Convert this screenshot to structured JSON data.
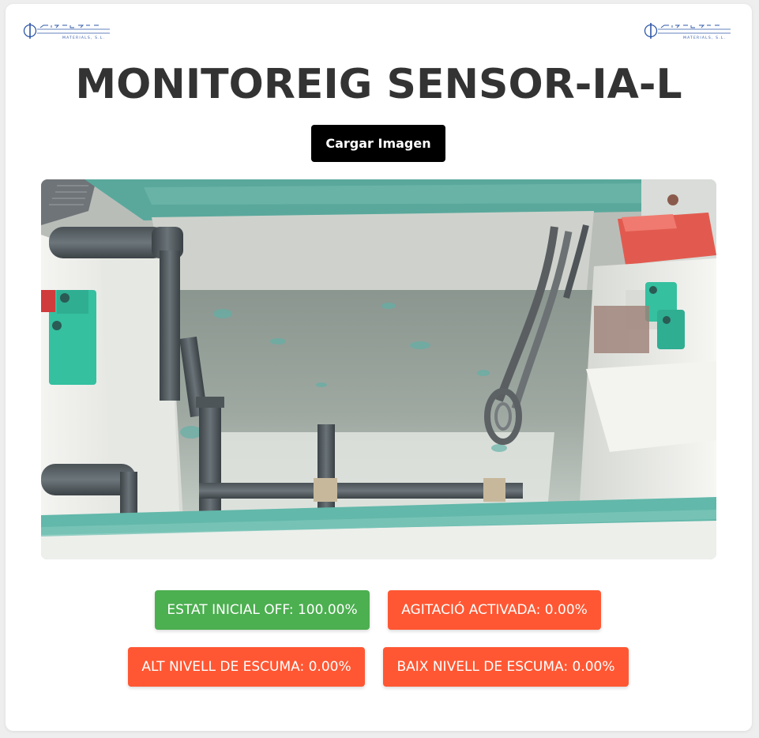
{
  "header": {
    "logo_left": "CHEMPLATE MATERIALS, S.L.",
    "logo_right": "CHEMPLATE MATERIALS, S.L.",
    "title": "MONITOREIG SENSOR-IA-L"
  },
  "actions": {
    "load_label": "Cargar Imagen"
  },
  "image": {
    "subject": "tank with pipes, heater and foam-covered liquid"
  },
  "status": [
    {
      "text": "ESTAT INICIAL OFF: 100.00%",
      "color": "#4caf50"
    },
    {
      "text": "AGITACIÓ ACTIVADA: 0.00%",
      "color": "#ff5733"
    },
    {
      "text": "ALT NIVELL DE ESCUMA: 0.00%",
      "color": "#ff5733"
    },
    {
      "text": "BAIX NIVELL DE ESCUMA: 0.00%",
      "color": "#ff5733"
    }
  ],
  "colors": {
    "accent_ok": "#4caf50",
    "accent_alert": "#ff5733",
    "button_bg": "#000000"
  }
}
